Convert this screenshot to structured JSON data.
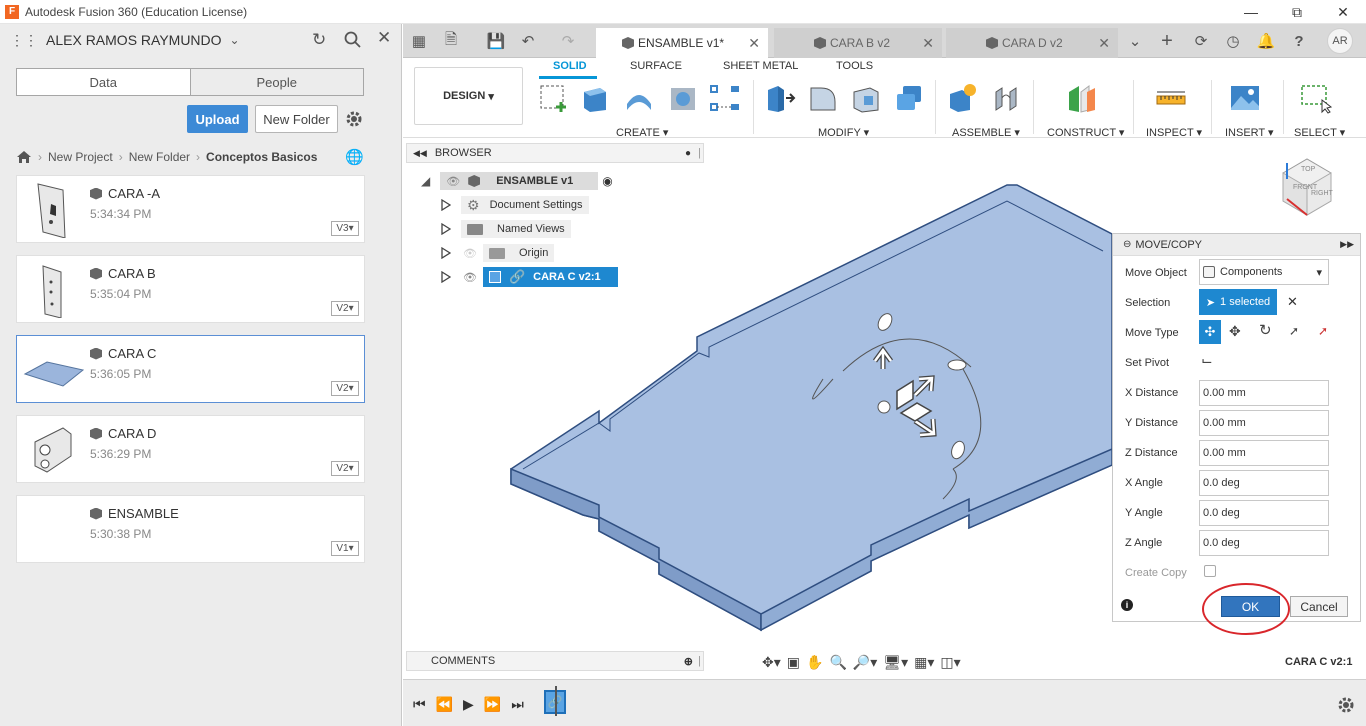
{
  "window": {
    "title": "Autodesk Fusion 360 (Education License)"
  },
  "user": {
    "name": "ALEX RAMOS RAYMUNDO"
  },
  "data_panel": {
    "tabs": [
      "Data",
      "People"
    ],
    "upload_label": "Upload",
    "new_folder_label": "New Folder",
    "breadcrumb": [
      "New Project",
      "New Folder",
      "Conceptos Basicos"
    ],
    "files": [
      {
        "name": "CARA -A",
        "time": "5:34:34 PM",
        "version": "V3"
      },
      {
        "name": "CARA B",
        "time": "5:35:04 PM",
        "version": "V2"
      },
      {
        "name": "CARA C",
        "time": "5:36:05 PM",
        "version": "V2"
      },
      {
        "name": "CARA D",
        "time": "5:36:29 PM",
        "version": "V2"
      },
      {
        "name": "ENSAMBLE",
        "time": "5:30:38 PM",
        "version": "V1"
      }
    ]
  },
  "doc_tabs": [
    "ENSAMBLE v1*",
    "CARA B v2",
    "CARA D v2"
  ],
  "user_initials": "AR",
  "ribbon": {
    "workspace": "DESIGN",
    "tabs": [
      "SOLID",
      "SURFACE",
      "SHEET METAL",
      "TOOLS"
    ],
    "groups": [
      "CREATE",
      "MODIFY",
      "ASSEMBLE",
      "CONSTRUCT",
      "INSPECT",
      "INSERT",
      "SELECT"
    ]
  },
  "browser": {
    "title": "BROWSER",
    "root": "ENSAMBLE v1",
    "items": [
      "Document Settings",
      "Named Views",
      "Origin",
      "CARA C v2:1"
    ]
  },
  "comments": {
    "title": "COMMENTS"
  },
  "status_selection": "CARA C v2:1",
  "dialog": {
    "title": "MOVE/COPY",
    "move_object_label": "Move Object",
    "move_object_value": "Components",
    "selection_label": "Selection",
    "selection_value": "1 selected",
    "move_type_label": "Move Type",
    "set_pivot_label": "Set Pivot",
    "fields": [
      {
        "label": "X Distance",
        "value": "0.00 mm"
      },
      {
        "label": "Y Distance",
        "value": "0.00 mm"
      },
      {
        "label": "Z Distance",
        "value": "0.00 mm"
      },
      {
        "label": "X Angle",
        "value": "0.0 deg"
      },
      {
        "label": "Y Angle",
        "value": "0.0 deg"
      },
      {
        "label": "Z Angle",
        "value": "0.0 deg"
      }
    ],
    "create_copy_label": "Create Copy",
    "ok_label": "OK",
    "cancel_label": "Cancel"
  },
  "viewcube": {
    "front": "FRONT",
    "right": "RIGHT",
    "top": "TOP"
  },
  "colors": {
    "accent": "#0696d7",
    "selection_blue": "#1e88d0",
    "body_blue": "#9bb5dc",
    "annotation_red": "#d9262b"
  }
}
